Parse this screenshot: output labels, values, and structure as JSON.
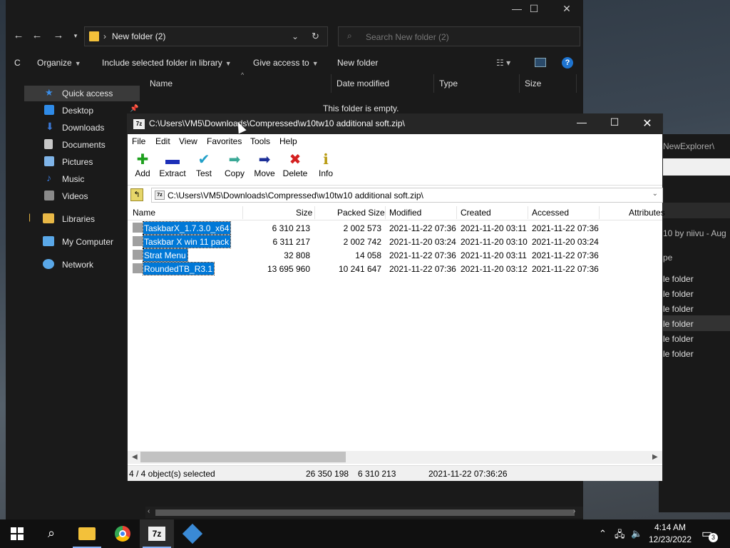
{
  "explorer": {
    "address": "New folder (2)",
    "search_placeholder": "Search New folder (2)",
    "toolbar": [
      {
        "label": "Organize"
      },
      {
        "label": "Include selected folder in library"
      },
      {
        "label": "Give access to"
      },
      {
        "label": "New folder"
      }
    ],
    "columns": [
      "Name",
      "Date modified",
      "Type",
      "Size"
    ],
    "empty_message": "This folder is empty.",
    "nav": [
      {
        "label": "Quick access",
        "icon": "star-icon",
        "color": "#3b8ee8"
      },
      {
        "label": "Desktop",
        "icon": "desktop-icon",
        "color": "#2f8be8"
      },
      {
        "label": "Downloads",
        "icon": "download-icon",
        "color": "#3a78d6"
      },
      {
        "label": "Documents",
        "icon": "document-icon",
        "color": "#c8c8c8"
      },
      {
        "label": "Pictures",
        "icon": "pictures-icon",
        "color": "#7fb4e8"
      },
      {
        "label": "Music",
        "icon": "music-icon",
        "color": "#3a78d6"
      },
      {
        "label": "Videos",
        "icon": "videos-icon",
        "color": "#8a8a8a"
      },
      {
        "label": "Libraries",
        "icon": "library-folder-icon",
        "color": "#e8b846"
      },
      {
        "label": "My Computer",
        "icon": "computer-icon",
        "color": "#5aa8e8"
      },
      {
        "label": "Network",
        "icon": "network-icon",
        "color": "#5aa8e8"
      }
    ]
  },
  "background_explorer": {
    "path_fragment": "NewExplorer\\",
    "line1": "10 by niivu - Aug",
    "col_fragment": "pe",
    "rows": [
      "le folder",
      "le folder",
      "le folder",
      "le folder",
      "le folder",
      "le folder"
    ]
  },
  "sevenzip": {
    "title": "C:\\Users\\VM5\\Downloads\\Compressed\\w10tw10 additional soft.zip\\",
    "app_icon": "7z",
    "menu": [
      "File",
      "Edit",
      "View",
      "Favorites",
      "Tools",
      "Help"
    ],
    "tools": [
      {
        "label": "Add",
        "icon": "add-icon",
        "glyph": "✚",
        "color": "#1ea01e"
      },
      {
        "label": "Extract",
        "icon": "extract-icon",
        "glyph": "▬",
        "color": "#1c2fb8"
      },
      {
        "label": "Test",
        "icon": "test-icon",
        "glyph": "✔",
        "color": "#22a0c8"
      },
      {
        "label": "Copy",
        "icon": "copy-icon",
        "glyph": "➡",
        "color": "#3aa896"
      },
      {
        "label": "Move",
        "icon": "move-icon",
        "glyph": "➡",
        "color": "#1c2f98"
      },
      {
        "label": "Delete",
        "icon": "delete-icon",
        "glyph": "✖",
        "color": "#d42020"
      },
      {
        "label": "Info",
        "icon": "info-icon",
        "glyph": "ℹ",
        "color": "#b89a10"
      }
    ],
    "path": "C:\\Users\\VM5\\Downloads\\Compressed\\w10tw10 additional soft.zip\\",
    "columns": [
      "Name",
      "Size",
      "Packed Size",
      "Modified",
      "Created",
      "Accessed",
      "Attributes"
    ],
    "files": [
      {
        "name": "TaskbarX_1.7.3.0_x64",
        "size": "6 310 213",
        "packed": "2 002 573",
        "modified": "2021-11-22 07:36",
        "created": "2021-11-20 03:11",
        "accessed": "2021-11-22 07:36"
      },
      {
        "name": "Taskbar X win 11 pack",
        "size": "6 311 217",
        "packed": "2 002 742",
        "modified": "2021-11-20 03:24",
        "created": "2021-11-20 03:10",
        "accessed": "2021-11-20 03:24"
      },
      {
        "name": "Strat Menu",
        "size": "32 808",
        "packed": "14 058",
        "modified": "2021-11-22 07:36",
        "created": "2021-11-20 03:11",
        "accessed": "2021-11-22 07:36"
      },
      {
        "name": "RoundedTB_R3.1",
        "size": "13 695 960",
        "packed": "10 241 647",
        "modified": "2021-11-22 07:36",
        "created": "2021-11-20 03:12",
        "accessed": "2021-11-22 07:36"
      }
    ],
    "status": {
      "selected": "4 / 4 object(s) selected",
      "size": "26 350 198",
      "packed": "6 310 213",
      "date": "2021-11-22 07:36:26"
    }
  },
  "taskbar": {
    "time": "4:14 AM",
    "date": "12/23/2022",
    "notifications": "3"
  }
}
